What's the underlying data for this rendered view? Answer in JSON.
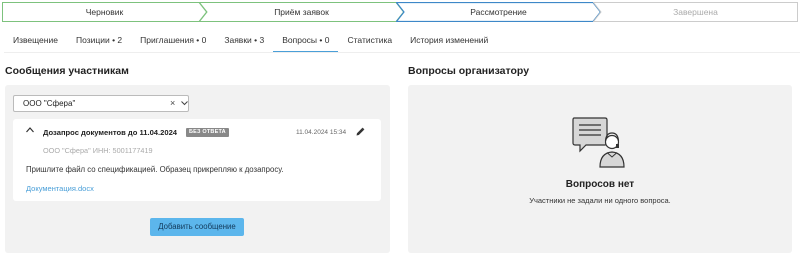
{
  "stepper": {
    "steps": [
      {
        "label": "Черновик",
        "state": "done"
      },
      {
        "label": "Приём заявок",
        "state": "done"
      },
      {
        "label": "Рассмотрение",
        "state": "current"
      },
      {
        "label": "Завершена",
        "state": "pending"
      }
    ],
    "colors": {
      "done": "#7dc27d",
      "current": "#3d88c8",
      "pending": "#cccccc"
    }
  },
  "tabs": [
    {
      "label": "Извещение",
      "active": false
    },
    {
      "label": "Позиции • 2",
      "active": false
    },
    {
      "label": "Приглашения • 0",
      "active": false
    },
    {
      "label": "Заявки • 3",
      "active": false
    },
    {
      "label": "Вопросы • 0",
      "active": true
    },
    {
      "label": "Статистика",
      "active": false
    },
    {
      "label": "История изменений",
      "active": false
    }
  ],
  "left": {
    "title": "Сообщения участникам",
    "participant_select": {
      "value": "ООО \"Сфера\"",
      "clear_glyph": "×"
    },
    "message": {
      "subject": "Дозапрос документов до 11.04.2024",
      "badge": "БЕЗ ОТВЕТА",
      "date": "11.04.2024 15:34",
      "sender": "ООО \"Сфера\" ИНН: 5001177419",
      "text": "Пришлите файл со спецификацией. Образец прикрепляю к дозапросу.",
      "attachment": "Документация.docx"
    },
    "add_button": "Добавить сообщение"
  },
  "right": {
    "title": "Вопросы организатору",
    "empty_title": "Вопросов нет",
    "empty_subtitle": "Участники не задали ни одного вопроса."
  },
  "icons": {
    "caret": "chevron-up-icon",
    "edit": "pencil-icon",
    "chevron": "chevron-down-icon",
    "illustration": "chat-person-icon"
  }
}
